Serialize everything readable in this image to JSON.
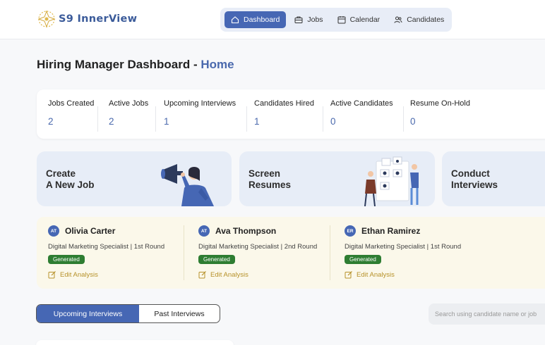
{
  "header": {
    "brand": "S9 InnerView",
    "nav": [
      {
        "label": "Dashboard",
        "icon": "home-icon",
        "active": true
      },
      {
        "label": "Jobs",
        "icon": "briefcase-icon",
        "active": false
      },
      {
        "label": "Calendar",
        "icon": "calendar-icon",
        "active": false
      },
      {
        "label": "Candidates",
        "icon": "users-icon",
        "active": false
      }
    ]
  },
  "page": {
    "title_prefix": "Hiring Manager Dashboard - ",
    "title_highlight": "Home"
  },
  "stats": [
    {
      "label": "Jobs Created",
      "value": "2"
    },
    {
      "label": "Active Jobs",
      "value": "2"
    },
    {
      "label": "Upcoming Interviews",
      "value": "1"
    },
    {
      "label": "Candidates Hired",
      "value": "1"
    },
    {
      "label": "Active Candidates",
      "value": "0"
    },
    {
      "label": "Resume On-Hold",
      "value": "0"
    }
  ],
  "actions": [
    {
      "line1": "Create",
      "line2": "A New Job"
    },
    {
      "line1": "Screen",
      "line2": "Resumes"
    },
    {
      "line1": "Conduct",
      "line2": "Interviews"
    }
  ],
  "interviews": [
    {
      "initials": "AT",
      "name": "Olivia Carter",
      "role": "Digital Marketing Specialist | 1st Round",
      "status": "Generated",
      "action": "Edit Analysis"
    },
    {
      "initials": "AT",
      "name": "Ava Thompson",
      "role": "Digital Marketing Specialist | 2nd Round",
      "status": "Generated",
      "action": "Edit Analysis"
    },
    {
      "initials": "ER",
      "name": "Ethan Ramirez",
      "role": "Digital Marketing Specialist | 1st Round",
      "status": "Generated",
      "action": "Edit Analysis"
    }
  ],
  "tabs": {
    "upcoming": "Upcoming Interviews",
    "past": "Past Interviews"
  },
  "search": {
    "placeholder": "Search using candidate name or job"
  },
  "colors": {
    "primary": "#4667b4",
    "accent_text": "#4a69ad",
    "badge": "#2e7d32",
    "edit_link": "#b7922a",
    "card_bg": "#e7edf7",
    "strip_bg": "#fbf8ea"
  }
}
